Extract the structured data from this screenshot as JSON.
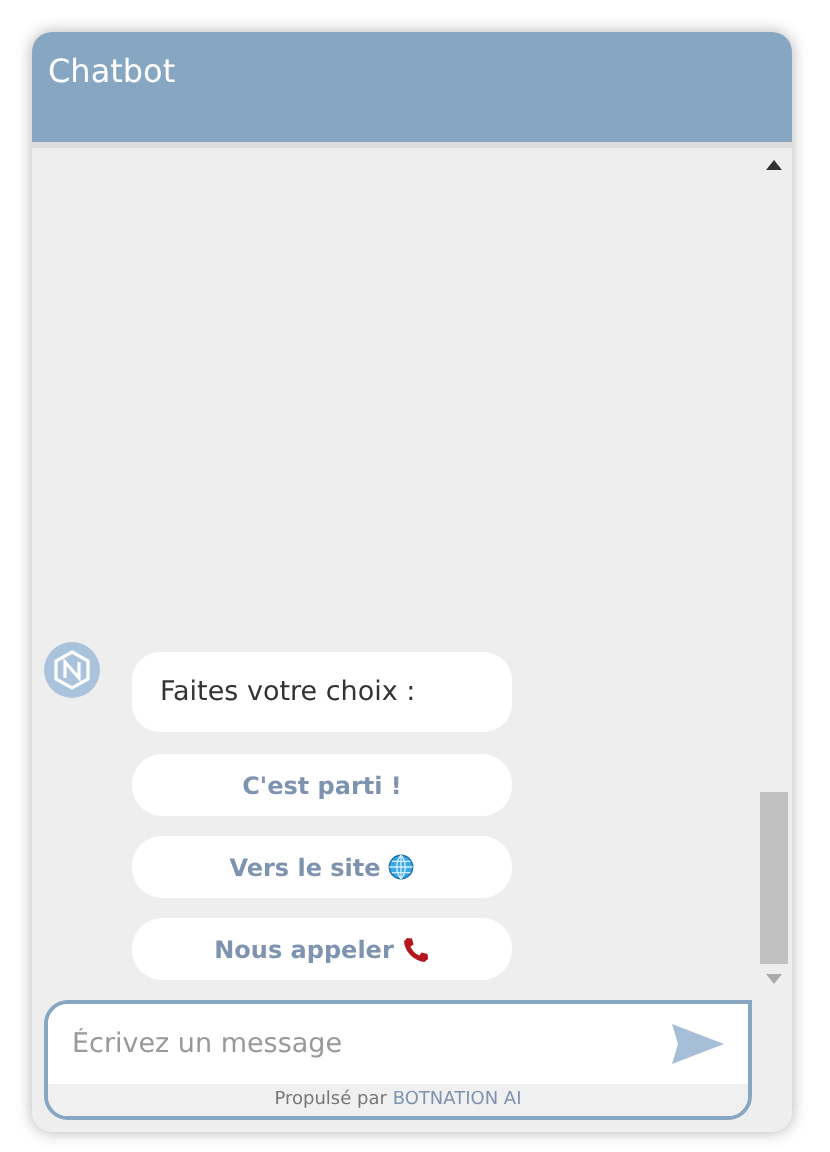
{
  "window": {
    "title": "Chatbot"
  },
  "messages": [
    {
      "text": "Faites votre choix :"
    }
  ],
  "choices": [
    {
      "label": "C'est parti !",
      "kind": "plain"
    },
    {
      "label": "Vers le site",
      "kind": "website"
    },
    {
      "label": "Nous appeler",
      "kind": "call"
    }
  ],
  "composer": {
    "placeholder": "Écrivez un message"
  },
  "footer": {
    "prefix": "Propulsé par",
    "brand": "BOTNATION AI"
  }
}
